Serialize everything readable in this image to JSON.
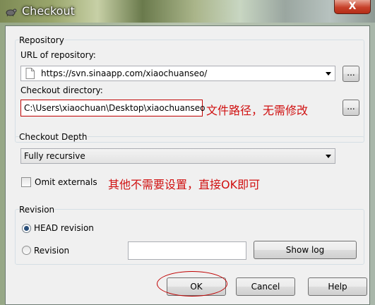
{
  "window": {
    "title": "Checkout",
    "close_label": "X"
  },
  "repository": {
    "group_label": "Repository",
    "url_label": "URL of repository:",
    "url_value": "https://svn.sinaapp.com/xiaochuanseo/",
    "browse_label": "...",
    "dir_label": "Checkout directory:",
    "dir_value": "C:\\Users\\xiaochuan\\Desktop\\xiaochuanseo",
    "dir_browse_label": "...",
    "annotation": "文件路径，无需修改"
  },
  "depth": {
    "group_label": "Checkout Depth",
    "selected": "Fully recursive",
    "omit_externals_label": "Omit externals",
    "omit_externals_checked": false,
    "annotation": "其他不需要设置，直接OK即可"
  },
  "revision": {
    "group_label": "Revision",
    "head_label": "HEAD revision",
    "revision_label": "Revision",
    "revision_value": "",
    "selected": "HEAD revision",
    "show_log_label": "Show log"
  },
  "buttons": {
    "ok": "OK",
    "cancel": "Cancel",
    "help": "Help"
  },
  "colors": {
    "annotation": "#d01010",
    "highlight_box": "#c00000"
  }
}
